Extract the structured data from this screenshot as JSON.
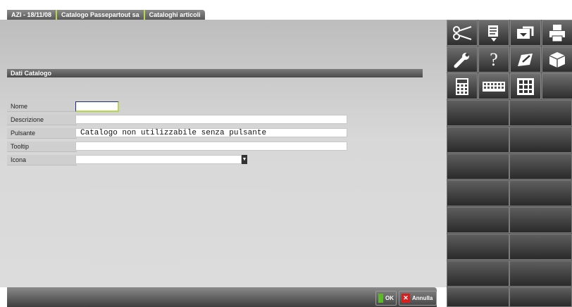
{
  "tabs": [
    {
      "label": "AZI - 18/11/08"
    },
    {
      "label": "Catalogo Passepartout sa"
    },
    {
      "label": "Cataloghi articoli"
    }
  ],
  "section": {
    "title": "Dati Catalogo"
  },
  "form": {
    "nome": {
      "label": "Nome",
      "value": ""
    },
    "descrizione": {
      "label": "Descrizione",
      "value": ""
    },
    "pulsante": {
      "label": "Pulsante",
      "value": "Catalogo non utilizzabile senza pulsante"
    },
    "tooltip": {
      "label": "Tooltip",
      "value": ""
    },
    "icona": {
      "label": "Icona",
      "value": ""
    }
  },
  "footer": {
    "ok_label": "OK",
    "cancel_label": "Annulla"
  },
  "toolbar": {
    "icons": [
      "scissors-icon",
      "document-icon",
      "export-icon",
      "printer-icon",
      "wrench-icon",
      "help-icon",
      "edit-icon",
      "cube-icon",
      "calculator-icon",
      "keyboard-icon",
      "grid-icon"
    ],
    "glyphs": {
      "help": "?"
    }
  }
}
